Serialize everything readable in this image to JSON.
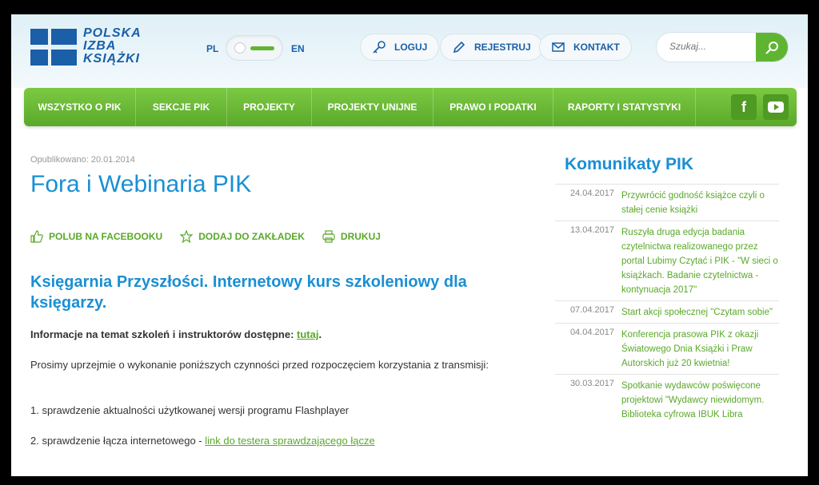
{
  "header": {
    "logo_lines": [
      "POLSKA",
      "IZBA",
      "KSIĄŻKI"
    ],
    "lang_left": "PL",
    "lang_right": "EN",
    "login_label": "LOGUJ",
    "register_label": "REJESTRUJ",
    "contact_label": "KONTAKT",
    "search_placeholder": "Szukaj..."
  },
  "nav": {
    "items": [
      "WSZYSTKO O PIK",
      "SEKCJE PIK",
      "PROJEKTY",
      "PROJEKTY UNIJNE",
      "PRAWO I PODATKI",
      "RAPORTY I STATYSTYKI"
    ],
    "facebook": "f"
  },
  "article": {
    "published": "Opublikowano: 20.01.2014",
    "title": "Fora i Webinaria PIK",
    "actions": [
      "POLUB NA FACEBOOKU",
      "DODAJ DO ZAKŁADEK",
      "DRUKUJ"
    ],
    "subtitle": "Księgarnia Przyszłości. Internetowy kurs szkoleniowy dla księgarzy.",
    "info_text": "Informacje na temat szkoleń i instruktorów dostępne: ",
    "info_link": "tutaj",
    "info_end": ".",
    "para1": " Prosimy uprzejmie o wykonanie poniższych czynności przed rozpoczęciem korzystania z transmisji:",
    "step1": "1. sprawdzenie aktualności użytkowanej wersji programu Flashplayer",
    "step2_text": "2. sprawdzenie łącza internetowego - ",
    "step2_link": "link do testera sprawdzającego łącze"
  },
  "sidebar": {
    "title": "Komunikaty PIK",
    "items": [
      {
        "date": "24.04.2017",
        "text": "Przywrócić godność książce czyli o stałej cenie książki"
      },
      {
        "date": "13.04.2017",
        "text": "Ruszyła druga edycja badania czytelnictwa realizowanego przez portal Lubimy Czytać i PIK - \"W sieci o książkach. Badanie czytelnictwa - kontynuacja 2017\""
      },
      {
        "date": "07.04.2017",
        "text": "Start akcji społecznej \"Czytam sobie\""
      },
      {
        "date": "04.04.2017",
        "text": "Konferencja prasowa PIK z okazji Światowego Dnia Książki i Praw Autorskich już 20 kwietnia!"
      },
      {
        "date": "30.03.2017",
        "text": "Spotkanie wydawców poświęcone projektowi \"Wydawcy niewidomym. Biblioteka cyfrowa IBUK Libra"
      }
    ]
  },
  "colors": {
    "accent_green": "#5fb531",
    "accent_blue": "#1a8fd4",
    "logo_blue": "#1a5fa8"
  }
}
